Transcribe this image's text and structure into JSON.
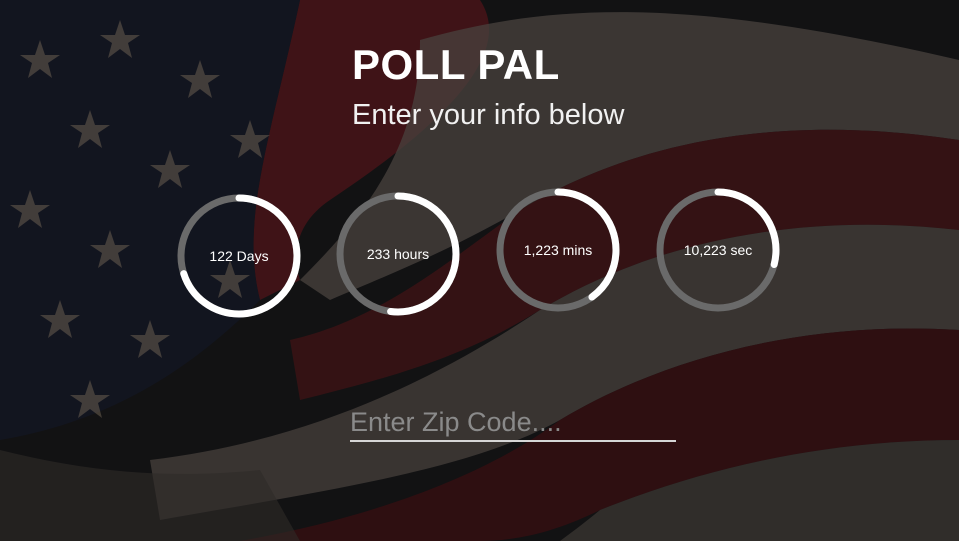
{
  "app": {
    "title": "POLL PAL",
    "subtitle": "Enter your info below"
  },
  "background": {
    "image": "american-flag",
    "base_color": "#141416",
    "red_stripe_color": "#5a161c",
    "white_stripe_color": "#5e5650",
    "canton_color": "#141a2a",
    "star_color": "#8a7a68"
  },
  "countdown": {
    "ring_track_color": "#6a6a6a",
    "ring_progress_color": "#ffffff",
    "timers": [
      {
        "label": "122 Days",
        "progress": 0.7
      },
      {
        "label": "233 hours",
        "progress": 0.52
      },
      {
        "label": "1,223 mins",
        "progress": 0.4
      },
      {
        "label": "10,223 sec",
        "progress": 0.29
      }
    ]
  },
  "zip": {
    "placeholder": "Enter Zip Code....",
    "value": ""
  }
}
